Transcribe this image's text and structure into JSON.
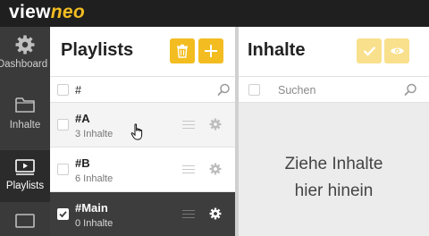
{
  "app": {
    "logo_part1": "view",
    "logo_part2": "neo",
    "accent_color": "#f3bd21"
  },
  "sidebar": {
    "items": [
      {
        "label": "Dashboard",
        "icon": "gear-icon"
      },
      {
        "label": "Inhalte",
        "icon": "folder-icon"
      },
      {
        "label": "Playlists",
        "icon": "playlist-icon",
        "active": true
      },
      {
        "label": "",
        "icon": "monitor-icon"
      }
    ]
  },
  "playlists": {
    "title": "Playlists",
    "delete_icon": "trash-icon",
    "add_icon": "plus-icon",
    "search_value": "#",
    "items": [
      {
        "name": "#A",
        "count": "3 Inhalte",
        "state": "hover",
        "checked": false
      },
      {
        "name": "#B",
        "count": "6 Inhalte",
        "state": "normal",
        "checked": false
      },
      {
        "name": "#Main",
        "count": "0 Inhalte",
        "state": "selected",
        "checked": true
      }
    ]
  },
  "inhalte": {
    "title": "Inhalte",
    "confirm_icon": "check-icon",
    "preview_icon": "eye-icon",
    "search_placeholder": "Suchen",
    "dropzone_line1": "Ziehe Inhalte",
    "dropzone_line2": "hier hinein"
  }
}
